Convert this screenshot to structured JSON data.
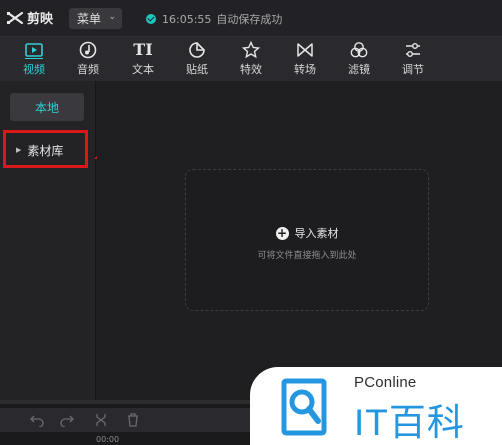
{
  "app": {
    "name": "剪映",
    "menu_label": "菜单",
    "save_time": "16:05:55",
    "save_status": "自动保存成功"
  },
  "toolbar": {
    "tabs": [
      {
        "label": "视频",
        "icon": "video-icon",
        "active": true
      },
      {
        "label": "音频",
        "icon": "music-note-icon",
        "active": false
      },
      {
        "label": "文本",
        "icon": "text-icon",
        "glyph": "TI",
        "active": false
      },
      {
        "label": "贴纸",
        "icon": "sticker-icon",
        "active": false
      },
      {
        "label": "特效",
        "icon": "effects-star-icon",
        "active": false
      },
      {
        "label": "转场",
        "icon": "transition-icon",
        "active": false
      },
      {
        "label": "滤镜",
        "icon": "filter-icon",
        "active": false
      },
      {
        "label": "调节",
        "icon": "adjust-sliders-icon",
        "active": false
      }
    ]
  },
  "sidebar": {
    "local_label": "本地",
    "library_label": "素材库"
  },
  "import": {
    "label": "导入素材",
    "hint": "可将文件直接拖入到此处"
  },
  "timeline": {
    "timecode": "00:00"
  },
  "watermark": {
    "brand_top": "PConline",
    "brand_main": "IT百科"
  },
  "colors": {
    "accent": "#2fd0d6",
    "annotation_red": "#d8181b",
    "watermark_blue": "#2597e0"
  }
}
